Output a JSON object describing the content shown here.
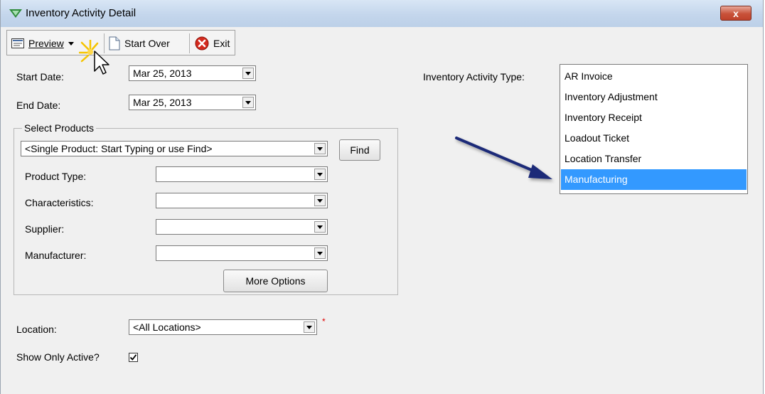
{
  "window": {
    "title": "Inventory Activity Detail",
    "close_glyph": "x"
  },
  "toolbar": {
    "preview_label": "Preview",
    "start_over_label": "Start Over",
    "exit_label": "Exit"
  },
  "form": {
    "start_date_label": "Start Date:",
    "start_date_value": "Mar 25, 2013",
    "end_date_label": "End Date:",
    "end_date_value": "Mar 25, 2013",
    "activity_type_label": "Inventory Activity Type:",
    "activity_types": [
      {
        "label": "AR Invoice",
        "selected": false
      },
      {
        "label": "Inventory Adjustment",
        "selected": false
      },
      {
        "label": "Inventory Receipt",
        "selected": false
      },
      {
        "label": "Loadout Ticket",
        "selected": false
      },
      {
        "label": "Location Transfer",
        "selected": false
      },
      {
        "label": "Manufacturing",
        "selected": true
      }
    ],
    "select_products": {
      "title": "Select Products",
      "product_value": "<Single Product: Start Typing or use Find>",
      "find_label": "Find",
      "product_type_label": "Product Type:",
      "characteristics_label": "Characteristics:",
      "supplier_label": "Supplier:",
      "manufacturer_label": "Manufacturer:",
      "more_options_label": "More Options"
    },
    "location_label": "Location:",
    "location_value": "<All Locations>",
    "required_marker": "*",
    "show_only_active_label": "Show Only Active?",
    "show_only_active_checked": true
  },
  "colors": {
    "selection": "#3399ff",
    "arrow": "#1a2a78",
    "close_button": "#c8523a"
  }
}
